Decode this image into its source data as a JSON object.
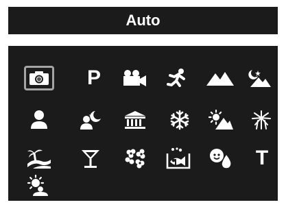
{
  "header": {
    "title": "Auto"
  },
  "modes": [
    {
      "name": "auto-camera",
      "icon": "camera-icon",
      "selected": true
    },
    {
      "name": "program",
      "icon": "p-letter-icon",
      "label": "P"
    },
    {
      "name": "movie",
      "icon": "movie-camera-icon"
    },
    {
      "name": "sports",
      "icon": "runner-icon"
    },
    {
      "name": "landscape",
      "icon": "mountain-icon"
    },
    {
      "name": "night-landscape",
      "icon": "moon-mountain-icon"
    },
    {
      "name": "portrait",
      "icon": "person-icon"
    },
    {
      "name": "night-portrait",
      "icon": "moon-person-icon"
    },
    {
      "name": "museum",
      "icon": "museum-icon"
    },
    {
      "name": "snow",
      "icon": "snowflake-icon"
    },
    {
      "name": "beach",
      "icon": "sun-mountain-icon"
    },
    {
      "name": "fireworks",
      "icon": "fireworks-icon"
    },
    {
      "name": "sunset",
      "icon": "palm-wave-icon"
    },
    {
      "name": "party",
      "icon": "cocktail-icon"
    },
    {
      "name": "flower",
      "icon": "flower-icon"
    },
    {
      "name": "underwater",
      "icon": "fish-tank-icon"
    },
    {
      "name": "baby-pet",
      "icon": "baby-drop-icon"
    },
    {
      "name": "text",
      "icon": "t-letter-icon",
      "label": "T"
    },
    {
      "name": "backlight-portrait",
      "icon": "sun-person-icon"
    }
  ],
  "colors": {
    "background": "#1b1b1b",
    "icon": "#ffffff",
    "selection": "#a5a5a5"
  }
}
